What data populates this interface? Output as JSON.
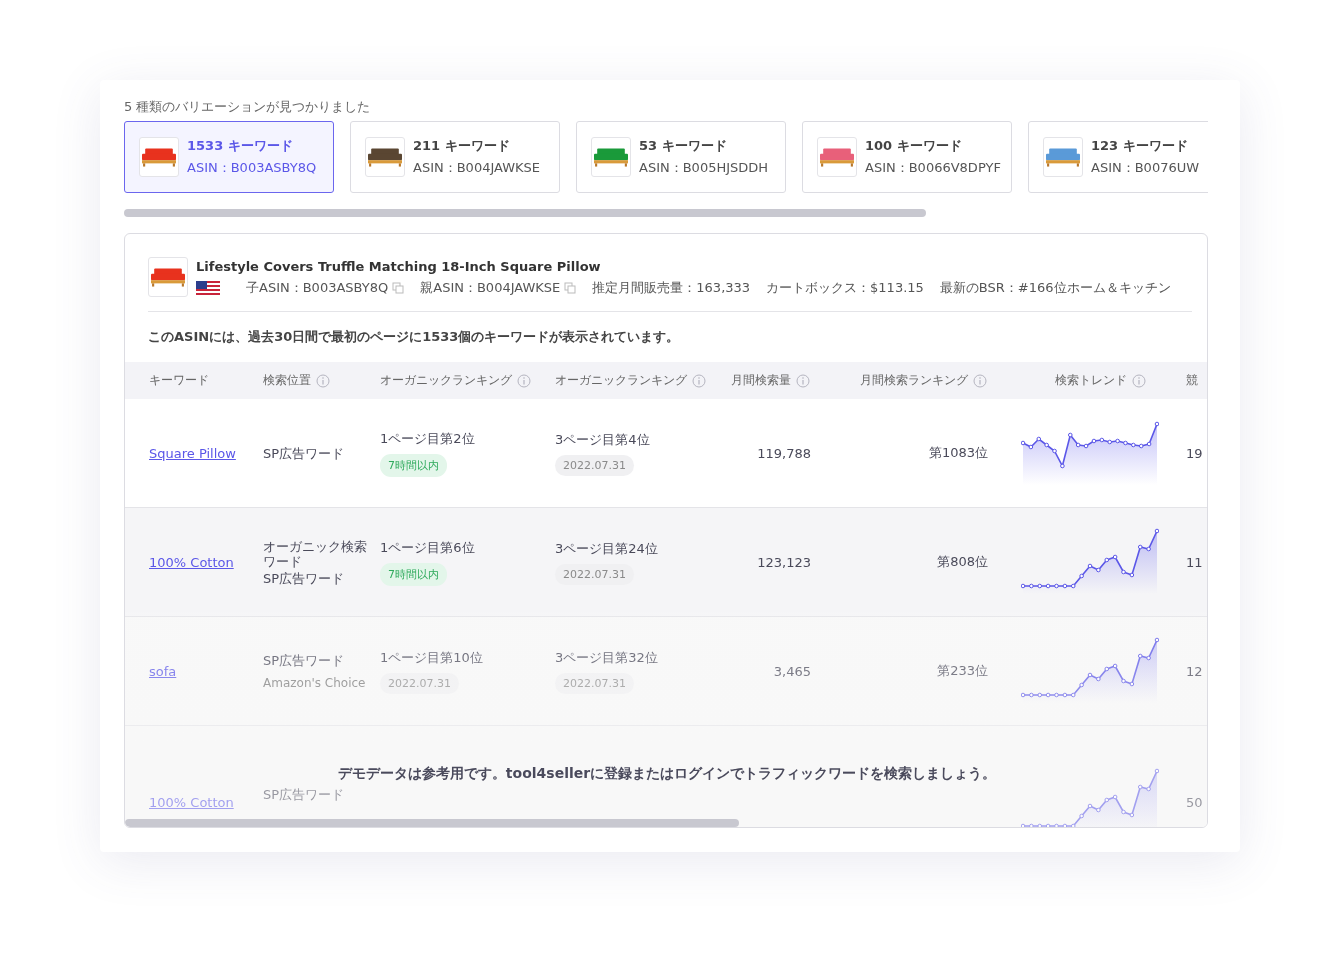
{
  "variations_heading": "5 種類のバリエーションが見つかりました",
  "variations": [
    {
      "keywords": "1533 キーワード",
      "asin": "ASIN：B003ASBY8Q",
      "color": "#e8321e",
      "selected": true
    },
    {
      "keywords": "211 キーワード",
      "asin": "ASIN：B004JAWKSE",
      "color": "#5a4632",
      "selected": false
    },
    {
      "keywords": "53 キーワード",
      "asin": "ASIN：B005HJSDDH",
      "color": "#1a9a3a",
      "selected": false
    },
    {
      "keywords": "100 キーワード",
      "asin": "ASIN：B0066V8DPYF",
      "color": "#e8607a",
      "selected": false
    },
    {
      "keywords": "123 キーワード",
      "asin": "ASIN：B0076UW",
      "color": "#5a9ad8",
      "selected": false
    }
  ],
  "product": {
    "title": "Lifestyle Covers Truffle Matching 18-Inch Square Pillow",
    "color": "#e8321e",
    "child_asin": "子ASIN：B003ASBY8Q",
    "parent_asin": "親ASIN：B004JAWKSE",
    "sales": "推定月間販売量：163,333",
    "cart_box": "カートボックス：$113.15",
    "bsr": "最新のBSR：#166位ホーム＆キッチン"
  },
  "notice": "このASINには、過去30日間で最初のページに1533個のキーワードが表示されています。",
  "table": {
    "columns": [
      {
        "label": "キーワード",
        "info": false
      },
      {
        "label": "検索位置",
        "info": true
      },
      {
        "label": "オーガニックランキング",
        "info": true
      },
      {
        "label": "オーガニックランキング",
        "info": true
      },
      {
        "label": "月間検索量",
        "info": true
      },
      {
        "label": "月間検索ランキング",
        "info": true
      },
      {
        "label": "検索トレンド",
        "info": true
      },
      {
        "label": "競",
        "info": false
      }
    ],
    "rows": [
      {
        "keyword": "Square Pillow",
        "position": [
          "SP広告ワード"
        ],
        "organic_1": {
          "rank": "1ページ目第2位",
          "badge": "7時間以内",
          "kind": "recent"
        },
        "organic_2": {
          "rank": "3ページ目第4位",
          "badge": "2022.07.31",
          "kind": "date"
        },
        "volume": "119,788",
        "ranking": "第1083位",
        "competition": "19"
      },
      {
        "keyword": "100% Cotton",
        "position": [
          "オーガニック検索ワード",
          "SP広告ワード"
        ],
        "organic_1": {
          "rank": "1ページ目第6位",
          "badge": "7時間以内",
          "kind": "recent"
        },
        "organic_2": {
          "rank": "3ページ目第24位",
          "badge": "2022.07.31",
          "kind": "date"
        },
        "volume": "123,123",
        "ranking": "第808位",
        "competition": "11"
      },
      {
        "keyword": "sofa",
        "position": [
          "SP広告ワード"
        ],
        "note": "Amazon's Choice",
        "organic_1": {
          "rank": "1ページ目第10位",
          "badge": "2022.07.31",
          "kind": "date"
        },
        "organic_2": {
          "rank": "3ページ目第32位",
          "badge": "2022.07.31",
          "kind": "date"
        },
        "volume": "3,465",
        "ranking": "第233位",
        "competition": "12"
      },
      {
        "keyword": "100% Cotton",
        "position": [
          "SP広告ワード"
        ],
        "competition": "50"
      }
    ]
  },
  "demo_message": "デモデータは参考用です。tool4sellerに登録またはログインでトラフィックワードを検索しましょう。"
}
